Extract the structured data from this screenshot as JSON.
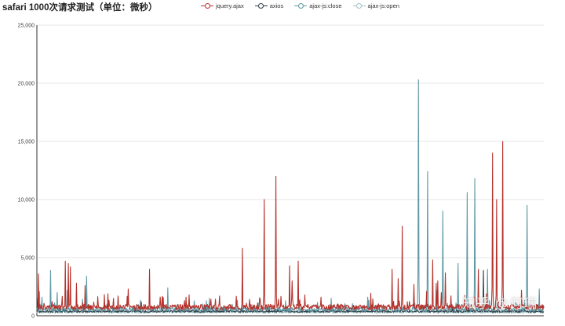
{
  "chart_data": {
    "type": "line",
    "title": "safari 1000次请求测试（单位：微秒）",
    "xlabel": "",
    "ylabel": "",
    "ylim": [
      0,
      25000
    ],
    "yticks": [
      "0",
      "5,000",
      "10,000",
      "15,000",
      "20,000",
      "25,000"
    ],
    "x_count": 1000,
    "grid": true,
    "legend_position": "top-center",
    "series": [
      {
        "name": "jquery.ajax",
        "color": "#b5322c",
        "baseline": 750,
        "noise": 400,
        "spikes": [
          [
            3,
            3600
          ],
          [
            56,
            4700
          ],
          [
            62,
            4500
          ],
          [
            66,
            4200
          ],
          [
            78,
            2800
          ],
          [
            95,
            2600
          ],
          [
            140,
            1900
          ],
          [
            160,
            1700
          ],
          [
            180,
            2300
          ],
          [
            222,
            4000
          ],
          [
            300,
            1800
          ],
          [
            360,
            1700
          ],
          [
            405,
            5800
          ],
          [
            448,
            10000
          ],
          [
            471,
            12000
          ],
          [
            498,
            4300
          ],
          [
            503,
            3000
          ],
          [
            515,
            4700
          ],
          [
            560,
            1600
          ],
          [
            700,
            4000
          ],
          [
            712,
            3200
          ],
          [
            720,
            7700
          ],
          [
            743,
            2700
          ],
          [
            768,
            2100
          ],
          [
            780,
            4800
          ],
          [
            787,
            2800
          ],
          [
            790,
            3000
          ],
          [
            797,
            2000
          ],
          [
            805,
            3700
          ],
          [
            870,
            4000
          ],
          [
            886,
            1900
          ],
          [
            898,
            14000
          ],
          [
            906,
            10000
          ],
          [
            918,
            15000
          ],
          [
            955,
            2200
          ]
        ]
      },
      {
        "name": "axios",
        "color": "#2f3e48",
        "baseline": 380,
        "noise": 160,
        "spikes": [
          [
            2,
            1500
          ],
          [
            150,
            700
          ],
          [
            850,
            900
          ],
          [
            880,
            3900
          ],
          [
            910,
            800
          ]
        ]
      },
      {
        "name": "ajax-js:close",
        "color": "#5e98a3",
        "baseline": 550,
        "noise": 300,
        "spikes": [
          [
            5,
            2100
          ],
          [
            10,
            1600
          ],
          [
            27,
            3900
          ],
          [
            40,
            2000
          ],
          [
            60,
            2200
          ],
          [
            98,
            3400
          ],
          [
            160,
            1600
          ],
          [
            258,
            2400
          ],
          [
            340,
            1500
          ],
          [
            580,
            1500
          ],
          [
            652,
            1600
          ],
          [
            752,
            20300
          ],
          [
            770,
            12400
          ],
          [
            788,
            2200
          ],
          [
            800,
            9000
          ],
          [
            830,
            4500
          ],
          [
            848,
            10600
          ],
          [
            863,
            11800
          ],
          [
            888,
            4000
          ],
          [
            966,
            9500
          ],
          [
            990,
            2300
          ]
        ]
      },
      {
        "name": "ajax-js:open",
        "color": "#9ec3c9",
        "baseline": 320,
        "noise": 180,
        "spikes": [
          [
            8,
            1000
          ],
          [
            120,
            800
          ],
          [
            500,
            700
          ],
          [
            760,
            900
          ],
          [
            840,
            1000
          ]
        ]
      }
    ]
  },
  "watermark": "知乎 @何瑞"
}
